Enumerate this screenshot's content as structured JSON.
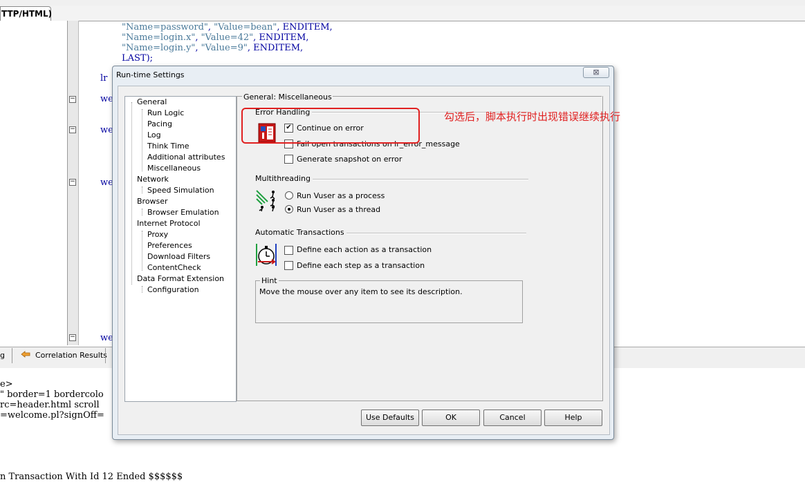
{
  "editor": {
    "tab_label": "TTP/HTML)",
    "lines": [
      {
        "a": "\"Name=password\"",
        "b": ", ",
        "c": "\"Value=bean\"",
        "d": ", ENDITEM,"
      },
      {
        "a": "\"Name=login.x\"",
        "b": ", ",
        "c": "\"Value=42\"",
        "d": ", ENDITEM,"
      },
      {
        "a": "\"Name=login.y\"",
        "b": ", ",
        "c": "\"Value=9\"",
        "d": ", ENDITEM,"
      }
    ],
    "last_line": "LAST);",
    "fragments": [
      "lr",
      "we",
      "we",
      "we",
      "we"
    ]
  },
  "bottom_tabs": {
    "log_label": "g",
    "correlation_label": "Correlation Results"
  },
  "output": {
    "lines": [
      "e>",
      "\" border=1 bordercolo",
      "rc=header.html scroll",
      "=welcome.pl?signOff="
    ],
    "last_line": "n Transaction With Id 12 Ended $$$$$$"
  },
  "dialog": {
    "title": "Run-time Settings",
    "close_label": "⊠",
    "tree": [
      {
        "label": "General",
        "level": 0
      },
      {
        "label": "Run Logic",
        "level": 1
      },
      {
        "label": "Pacing",
        "level": 1
      },
      {
        "label": "Log",
        "level": 1
      },
      {
        "label": "Think Time",
        "level": 1
      },
      {
        "label": "Additional attributes",
        "level": 1
      },
      {
        "label": "Miscellaneous",
        "level": 1
      },
      {
        "label": "Network",
        "level": 0
      },
      {
        "label": "Speed Simulation",
        "level": 1
      },
      {
        "label": "Browser",
        "level": 0
      },
      {
        "label": "Browser Emulation",
        "level": 1
      },
      {
        "label": "Internet Protocol",
        "level": 0
      },
      {
        "label": "Proxy",
        "level": 1
      },
      {
        "label": "Preferences",
        "level": 1
      },
      {
        "label": "Download Filters",
        "level": 1
      },
      {
        "label": "ContentCheck",
        "level": 1
      },
      {
        "label": "Data Format Extension",
        "level": 0
      },
      {
        "label": "Configuration",
        "level": 1
      }
    ],
    "panel_title": "General: Miscellaneous",
    "error_handling": {
      "label": "Error Handling",
      "continue_on_error": "Continue on error",
      "continue_checked": "✔",
      "fail_open": "Fail open transactions on lr_error_message",
      "snapshot": "Generate snapshot on error"
    },
    "multithreading": {
      "label": "Multithreading",
      "process": "Run Vuser as a process",
      "thread": "Run Vuser as a thread"
    },
    "auto_transactions": {
      "label": "Automatic Transactions",
      "each_action": "Define each action as a transaction",
      "each_step": "Define each step as a transaction"
    },
    "hint": {
      "label": "Hint",
      "text": "Move the mouse over any item to see its description."
    },
    "buttons": {
      "defaults": "Use Defaults",
      "ok": "OK",
      "cancel": "Cancel",
      "help": "Help"
    }
  },
  "annotation": "勾选后，脚本执行时出现错误继续执行",
  "colors": {
    "annotation": "#e02020"
  }
}
